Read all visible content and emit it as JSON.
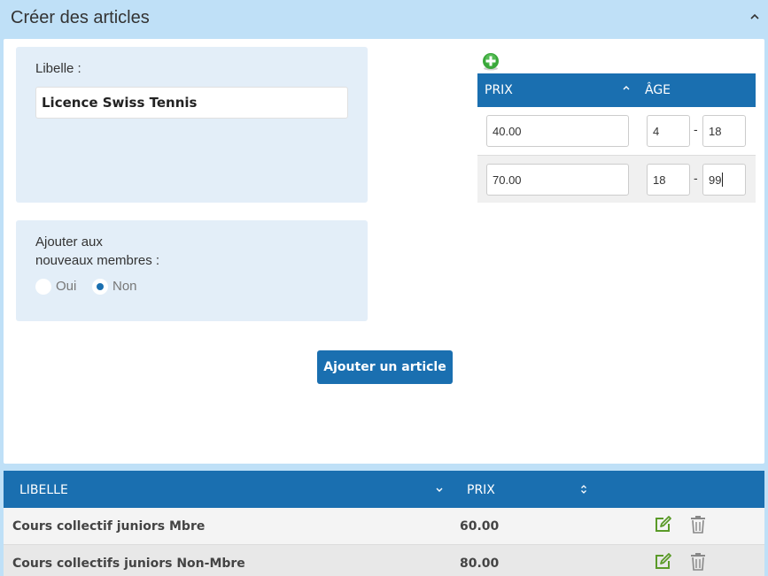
{
  "header": {
    "title": "Créer des articles"
  },
  "form": {
    "libelle_label": "Libelle :",
    "libelle_value": "Licence Swiss Tennis",
    "ajouter_label_line1": "Ajouter aux",
    "ajouter_label_line2": "nouveaux membres :",
    "radio_oui": "Oui",
    "radio_non": "Non",
    "selected_option": "Non",
    "submit_label": "Ajouter un article"
  },
  "price_table": {
    "col_prix": "PRIX",
    "col_age": "ÂGE",
    "age_separator": "-",
    "rows": [
      {
        "prix": "40.00",
        "age_from": "4",
        "age_to": "18"
      },
      {
        "prix": "70.00",
        "age_from": "18",
        "age_to": "99"
      }
    ]
  },
  "articles_table": {
    "col_libelle": "LIBELLE",
    "col_prix": "PRIX",
    "rows": [
      {
        "libelle": "Cours collectif juniors Mbre",
        "prix": "60.00"
      },
      {
        "libelle": "Cours collectifs juniors Non-Mbre",
        "prix": "80.00"
      }
    ]
  },
  "colors": {
    "primary": "#1a6fb0",
    "background": "#bfe0f7",
    "box": "#e3eef8",
    "edit_icon": "#5a9a28",
    "add_icon": "#3aa83a"
  }
}
